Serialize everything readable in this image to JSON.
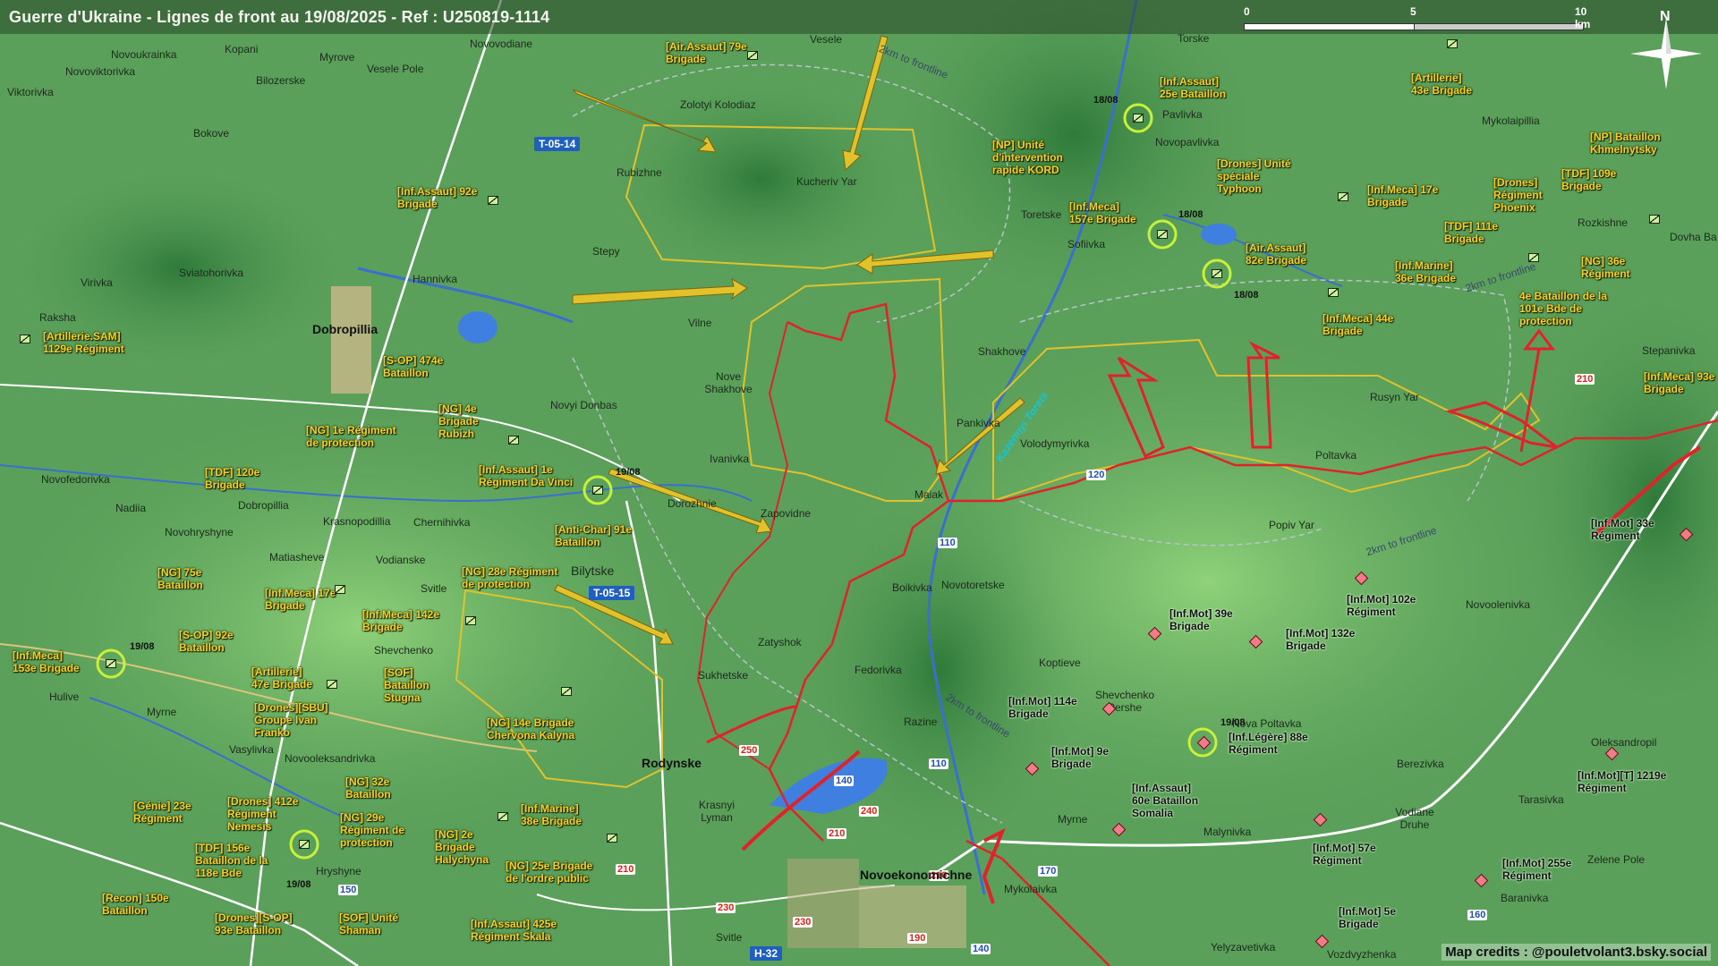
{
  "title": "Guerre d'Ukraine - Lignes de front au 19/08/2025 - Ref : U250819-1114",
  "scale": {
    "zero": "0",
    "mid": "5",
    "end": "10 km"
  },
  "compass_letter": "N",
  "credits": "Map credits : @pouletvolant3.bsky.social",
  "colors": {
    "terrain": "#5aa05a",
    "ua_front": "#e2c22a",
    "ru_front": "#e0232b",
    "road": "#ffffff"
  },
  "roads": [
    {
      "label": "T-05-14"
    },
    {
      "label": "T-05-15"
    },
    {
      "label": "H-32"
    }
  ],
  "road_numbers_red": [
    "210",
    "250",
    "240",
    "210",
    "210",
    "230",
    "230",
    "190",
    "210"
  ],
  "road_numbers_blue": [
    "110",
    "110",
    "120",
    "140",
    "150",
    "140",
    "160",
    "170"
  ],
  "frontline_labels": [
    "2km to frontline",
    "2km to frontline",
    "2km to frontline",
    "2km to frontline"
  ],
  "river_label": "Kazennyi Torets",
  "places": [
    "Novovodiane",
    "Vesele",
    "Novoukrainka",
    "Kopani",
    "Myrove",
    "Vesele Pole",
    "Novoviktorivka",
    "Bilozerske",
    "Viktorivka",
    "Zolotyi Kolodiaz",
    "Bokove",
    "Rubizhne",
    "Kucheriv Yar",
    "Stepy",
    "Sviatohorivka",
    "Hannivka",
    "Virivka",
    "Raksha",
    "Dobropillia",
    "Vilne",
    "Nove Shakhove",
    "Novyi Donbas",
    "Ivanivka",
    "Novofedorivka",
    "Dorozhnie",
    "Zapovidne",
    "Nadiia",
    "Dobropillia",
    "Novohryshyne",
    "Krasnopodillia",
    "Chernihivka",
    "Matiasheve",
    "Vodianske",
    "Svitle",
    "Bilytske",
    "Shevchenko",
    "Hulive",
    "Myrne",
    "Vasylivka",
    "Novooleksandrivka",
    "Hryshyne",
    "Rodynske",
    "Sukhetske",
    "Zatyshok",
    "Krasnyi Lyman",
    "Fedorivka",
    "Razine",
    "Novoekonomichne",
    "Svitle",
    "Boikivka",
    "Novotoretske",
    "Maiak",
    "Pankivka",
    "Volodymyrivka",
    "Shakhove",
    "Toretske",
    "Sofiivka",
    "Torske",
    "Pavlivka",
    "Novopavlivka",
    "Mykolaipillia",
    "Rozkishne",
    "Dovha Ba",
    "Stepanivka",
    "Rusyn Yar",
    "Poltavka",
    "Popiv Yar",
    "Koptieve",
    "Shevchenko Pershe",
    "Nova Poltavka",
    "Novoolenivka",
    "Oleksandropil",
    "Berezivka",
    "Vodiane Druhe",
    "Tarasivka",
    "Zelene Pole",
    "Baranivka",
    "Malynivka",
    "Myrne",
    "Mykolaivka",
    "Yelyzavetivka",
    "Vozdvyzhenka"
  ],
  "ua_units": [
    "[Air.Assaut] 79e Brigade",
    "[Inf.Assaut] 92e Brigade",
    "[Artillerie.SAM] 1129e Régiment",
    "[S-OP] 474e Bataillon",
    "[NG] 4e Brigade Rubizh",
    "[NG] 1e Régiment de protection",
    "[Inf.Assaut] 1e Régiment Da Vinci",
    "[TDF] 120e Brigade",
    "[Anti-Char] 91e Bataillon",
    "[NG] 28e Régiment de protection",
    "[NG] 75e Bataillon",
    "[Inf.Meca] 17e Brigade",
    "[Inf.Meca] 142e Brigade",
    "[Inf.Meca] 153e Brigade",
    "[S-OP] 92e Bataillon",
    "[Artillerie] 47e Brigade",
    "[SOF] Bataillon Stugna",
    "[Drones][SBU] Groupe Ivan Franko",
    "[NG] 14e Brigade Chervona Kalyna",
    "[NG] 32e Bataillon",
    "[Génie] 23e Régiment",
    "[Drones] 412e Régiment Nemesis",
    "[NG] 29e Régiment de protection",
    "[NG] 2e Brigade Halychyna",
    "[Inf.Marine] 38e Brigade",
    "[TDF] 156e Bataillon de la 118e Bde",
    "[NG] 25e Brigade de l'ordre public",
    "[Recon] 150e Bataillon",
    "[Drones][S-OP] 93e Bataillon",
    "[SOF] Unité Shaman",
    "[Inf.Assaut] 425e Régiment Skala",
    "[NP] Unité d'intervention rapide KORD",
    "[Inf.Assaut] 25e Bataillon",
    "[Drones] Unité spéciale Typhoon",
    "[Inf.Meca] 157e Brigade",
    "[Air.Assaut] 82e Brigade",
    "[Artillerie] 43e Brigade",
    "[Inf.Meca] 17e Brigade",
    "[TDF] 111e Brigade",
    "[Drones] Régiment Phoenix",
    "[TDF] 109e Brigade",
    "[NP] Bataillon Khmelnytsky",
    "[Inf.Marine] 36e Brigade",
    "[Inf.Meca] 44e Brigade",
    "[NG] 36e Régiment",
    "4e Bataillon de la 101e Bde de protection",
    "[Inf.Meca] 93e Brigade"
  ],
  "ru_units": [
    "[Inf.Mot] 33e Régiment",
    "[Inf.Mot] 102e Régiment",
    "[Inf.Mot] 39e Brigade",
    "[Inf.Mot] 132e Brigade",
    "[Inf.Mot] 114e Brigade",
    "[Inf.Légère] 88e Régiment",
    "[Inf.Mot] 9e Brigade",
    "[Inf.Assaut] 60e Bataillon Somalia",
    "[Inf.Mot] 57e Régiment",
    "[Inf.Mot] 5e Brigade",
    "[Inf.Mot] 255e Régiment",
    "[Inf.Mot][T] 1219e Régiment"
  ],
  "dates": [
    "18/08",
    "18/08",
    "18/08",
    "19/08",
    "19/08",
    "19/08",
    "19/08"
  ]
}
